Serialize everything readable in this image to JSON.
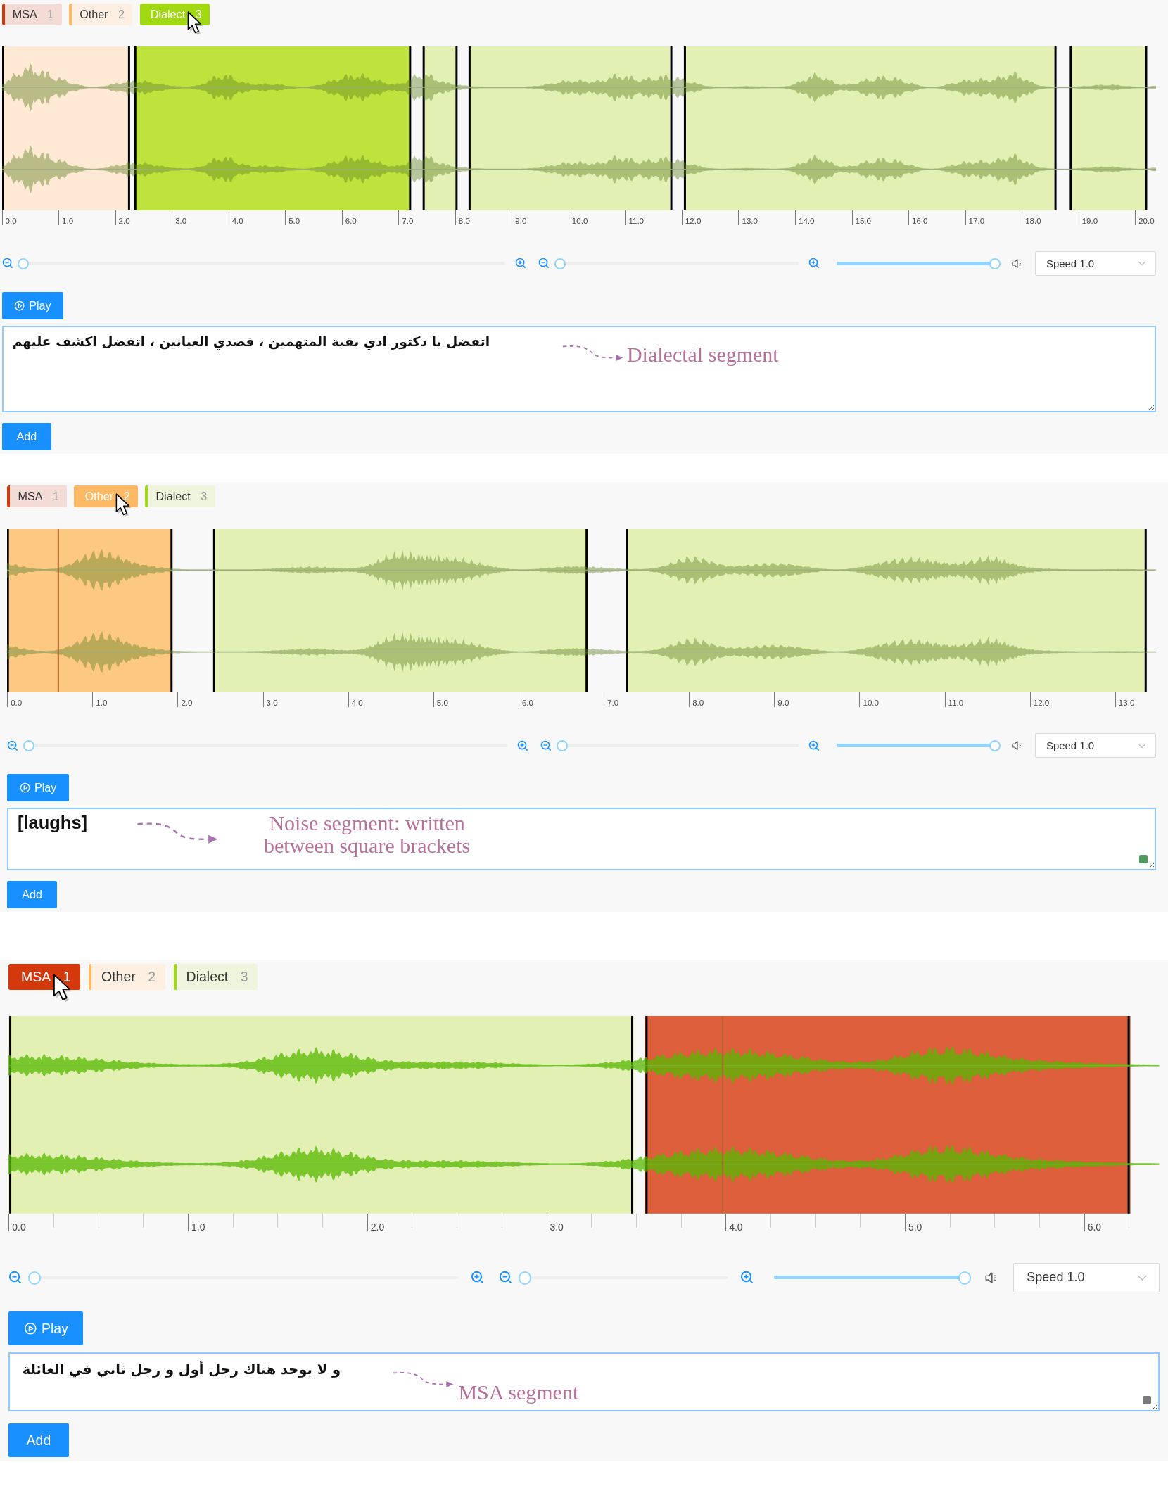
{
  "panels": [
    {
      "tabs": [
        {
          "label": "MSA",
          "key": "1",
          "kind": "msa",
          "selected": false
        },
        {
          "label": "Other",
          "key": "2",
          "kind": "other",
          "selected": false
        },
        {
          "label": "Dialect",
          "key": "3",
          "kind": "dialect",
          "selected": true
        }
      ],
      "regions": [
        {
          "kind": "other",
          "selected": false
        },
        {
          "kind": "dialect",
          "selected": true
        },
        {
          "kind": "dialect",
          "selected": false
        },
        {
          "kind": "dialect",
          "selected": false
        },
        {
          "kind": "dialect",
          "selected": false
        },
        {
          "kind": "dialect",
          "selected": false
        }
      ],
      "axis": {
        "ticks": [
          "0.0",
          "1.0",
          "2.0",
          "3.0",
          "4.0",
          "5.0",
          "6.0",
          "7.0",
          "8.0",
          "9.0",
          "10.0",
          "11.0",
          "12.0",
          "13.0",
          "14.0",
          "15.0",
          "16.0",
          "17.0",
          "18.0",
          "19.0",
          "20.0"
        ]
      },
      "zoom_sliders": [
        {
          "level": 0
        },
        {
          "level": 0
        }
      ],
      "volume": {
        "level": 1
      },
      "speed": "Speed 1.0",
      "play": "Play",
      "editor": {
        "value": "اتفضل يا دكتور ادي بقية المتهمين ، قصدي العيانين ، اتفضل اكشف عليهم"
      },
      "annotation": "Dialectal segment",
      "add": "Add"
    },
    {
      "tabs": [
        {
          "label": "MSA",
          "key": "1",
          "kind": "msa",
          "selected": false
        },
        {
          "label": "Other",
          "key": "2",
          "kind": "other",
          "selected": true
        },
        {
          "label": "Dialect",
          "key": "3",
          "kind": "dialect",
          "selected": false
        }
      ],
      "regions": [
        {
          "kind": "other",
          "selected": true
        },
        {
          "kind": "dialect",
          "selected": false
        },
        {
          "kind": "dialect",
          "selected": false
        }
      ],
      "playhead": {
        "level": 0.044
      },
      "axis": {
        "ticks": [
          "0.0",
          "1.0",
          "2.0",
          "3.0",
          "4.0",
          "5.0",
          "6.0",
          "7.0",
          "8.0",
          "9.0",
          "10.0",
          "11.0",
          "12.0",
          "13.0"
        ]
      },
      "zoom_sliders": [
        {
          "level": 0
        },
        {
          "level": 0
        }
      ],
      "volume": {
        "level": 1
      },
      "speed": "Speed 1.0",
      "play": "Play",
      "editor": {
        "value": "[laughs]",
        "color": "#4f9a5c"
      },
      "annotation": "Noise segment: written between square brackets",
      "add": "Add"
    },
    {
      "tabs": [
        {
          "label": "MSA",
          "key": "1",
          "kind": "msa",
          "selected": true
        },
        {
          "label": "Other",
          "key": "2",
          "kind": "other",
          "selected": false
        },
        {
          "label": "Dialect",
          "key": "3",
          "kind": "dialect",
          "selected": false
        }
      ],
      "regions": [
        {
          "kind": "dialect",
          "selected": false
        },
        {
          "kind": "msa",
          "selected": true
        }
      ],
      "playhead": {
        "level": 0.62
      },
      "axis": {
        "ticks": [
          "0.0",
          "1.0",
          "2.0",
          "3.0",
          "4.0",
          "5.0",
          "6.0"
        ],
        "minor_ticks": true
      },
      "zoom_sliders": [
        {
          "level": 0
        },
        {
          "level": 0
        }
      ],
      "volume": {
        "level": 1
      },
      "speed": "Speed 1.0",
      "play": "Play",
      "editor": {
        "value": "و لا يوجد هناك رجل أول و رجل ثاني في العائلة",
        "color": "#7a7a7a"
      },
      "annotation": "MSA segment",
      "add": "Add"
    }
  ]
}
